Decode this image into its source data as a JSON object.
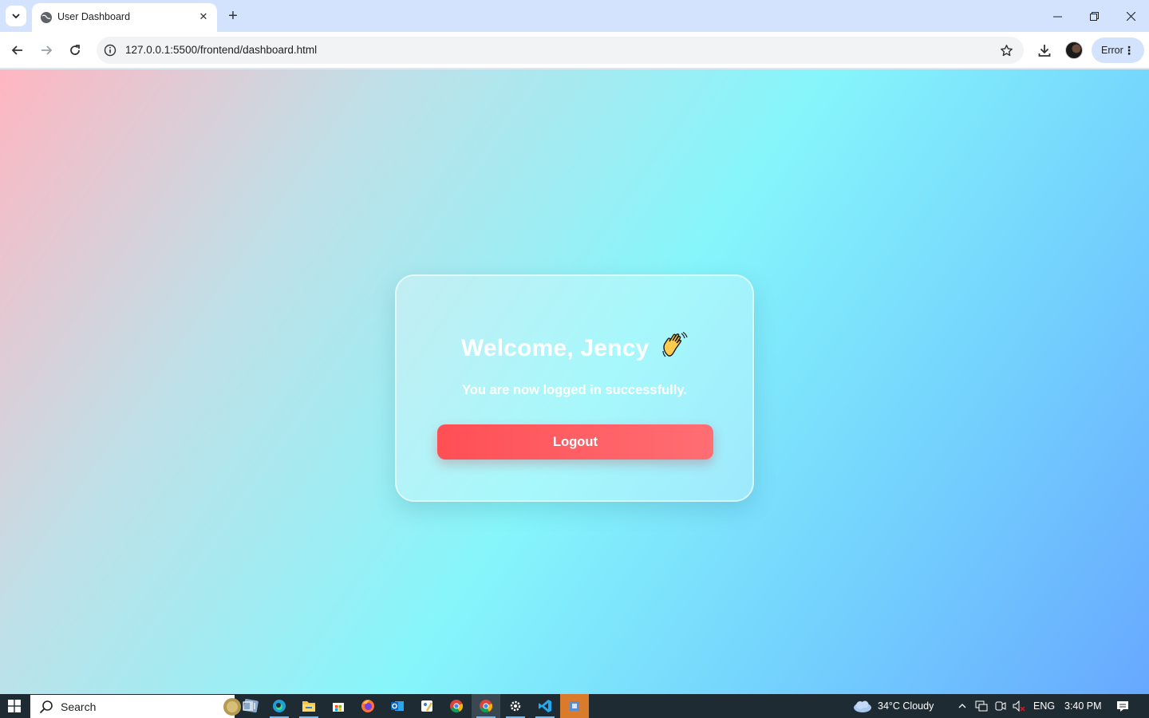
{
  "browser": {
    "tab_title": "User Dashboard",
    "url": "127.0.0.1:5500/frontend/dashboard.html",
    "profile_chip_label": "Error",
    "accent_color": "#d3e3fd"
  },
  "page": {
    "welcome_heading": "Welcome, Jency",
    "wave_emoji": "waving-hand-icon",
    "subtitle": "You are now logged in successfully.",
    "logout_label": "Logout",
    "button_color": "#ff5a5f",
    "text_color": "#ffffff"
  },
  "taskbar": {
    "search_label": "Search",
    "weather": "34°C  Cloudy",
    "language": "ENG",
    "time": "3:40 PM",
    "apps": [
      "task-view-icon",
      "edge-icon",
      "file-explorer-icon",
      "store-icon",
      "firefox-icon",
      "outlook-icon",
      "paint-icon",
      "chrome-icon",
      "chrome-active-icon",
      "settings-icon",
      "vscode-icon",
      "app-icon"
    ]
  }
}
